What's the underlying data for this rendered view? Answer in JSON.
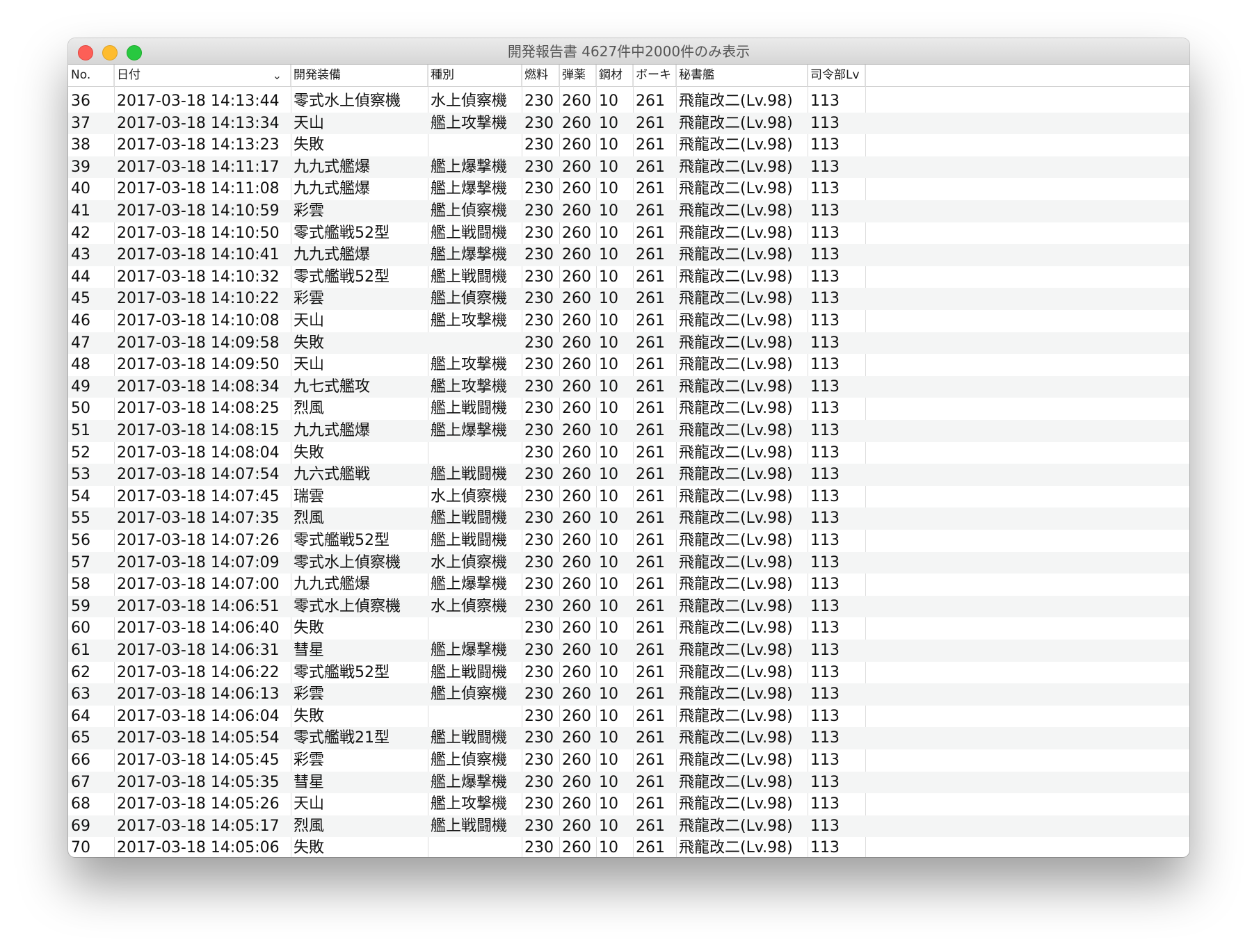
{
  "window": {
    "title": "開発報告書 4627件中2000件のみ表示"
  },
  "columns": {
    "no": "No.",
    "date": "日付",
    "equipment": "開発装備",
    "type": "種別",
    "fuel": "燃料",
    "ammo": "弾薬",
    "steel": "鋼材",
    "bauxite": "ボーキ",
    "secretary": "秘書艦",
    "hq_level": "司令部Lv"
  },
  "rows": [
    [
      "36",
      "2017-03-18 14:13:44",
      "零式水上偵察機",
      "水上偵察機",
      "230",
      "260",
      "10",
      "261",
      "飛龍改二(Lv.98)",
      "113"
    ],
    [
      "37",
      "2017-03-18 14:13:34",
      "天山",
      "艦上攻撃機",
      "230",
      "260",
      "10",
      "261",
      "飛龍改二(Lv.98)",
      "113"
    ],
    [
      "38",
      "2017-03-18 14:13:23",
      "失敗",
      "",
      "230",
      "260",
      "10",
      "261",
      "飛龍改二(Lv.98)",
      "113"
    ],
    [
      "39",
      "2017-03-18 14:11:17",
      "九九式艦爆",
      "艦上爆撃機",
      "230",
      "260",
      "10",
      "261",
      "飛龍改二(Lv.98)",
      "113"
    ],
    [
      "40",
      "2017-03-18 14:11:08",
      "九九式艦爆",
      "艦上爆撃機",
      "230",
      "260",
      "10",
      "261",
      "飛龍改二(Lv.98)",
      "113"
    ],
    [
      "41",
      "2017-03-18 14:10:59",
      "彩雲",
      "艦上偵察機",
      "230",
      "260",
      "10",
      "261",
      "飛龍改二(Lv.98)",
      "113"
    ],
    [
      "42",
      "2017-03-18 14:10:50",
      "零式艦戦52型",
      "艦上戦闘機",
      "230",
      "260",
      "10",
      "261",
      "飛龍改二(Lv.98)",
      "113"
    ],
    [
      "43",
      "2017-03-18 14:10:41",
      "九九式艦爆",
      "艦上爆撃機",
      "230",
      "260",
      "10",
      "261",
      "飛龍改二(Lv.98)",
      "113"
    ],
    [
      "44",
      "2017-03-18 14:10:32",
      "零式艦戦52型",
      "艦上戦闘機",
      "230",
      "260",
      "10",
      "261",
      "飛龍改二(Lv.98)",
      "113"
    ],
    [
      "45",
      "2017-03-18 14:10:22",
      "彩雲",
      "艦上偵察機",
      "230",
      "260",
      "10",
      "261",
      "飛龍改二(Lv.98)",
      "113"
    ],
    [
      "46",
      "2017-03-18 14:10:08",
      "天山",
      "艦上攻撃機",
      "230",
      "260",
      "10",
      "261",
      "飛龍改二(Lv.98)",
      "113"
    ],
    [
      "47",
      "2017-03-18 14:09:58",
      "失敗",
      "",
      "230",
      "260",
      "10",
      "261",
      "飛龍改二(Lv.98)",
      "113"
    ],
    [
      "48",
      "2017-03-18 14:09:50",
      "天山",
      "艦上攻撃機",
      "230",
      "260",
      "10",
      "261",
      "飛龍改二(Lv.98)",
      "113"
    ],
    [
      "49",
      "2017-03-18 14:08:34",
      "九七式艦攻",
      "艦上攻撃機",
      "230",
      "260",
      "10",
      "261",
      "飛龍改二(Lv.98)",
      "113"
    ],
    [
      "50",
      "2017-03-18 14:08:25",
      "烈風",
      "艦上戦闘機",
      "230",
      "260",
      "10",
      "261",
      "飛龍改二(Lv.98)",
      "113"
    ],
    [
      "51",
      "2017-03-18 14:08:15",
      "九九式艦爆",
      "艦上爆撃機",
      "230",
      "260",
      "10",
      "261",
      "飛龍改二(Lv.98)",
      "113"
    ],
    [
      "52",
      "2017-03-18 14:08:04",
      "失敗",
      "",
      "230",
      "260",
      "10",
      "261",
      "飛龍改二(Lv.98)",
      "113"
    ],
    [
      "53",
      "2017-03-18 14:07:54",
      "九六式艦戦",
      "艦上戦闘機",
      "230",
      "260",
      "10",
      "261",
      "飛龍改二(Lv.98)",
      "113"
    ],
    [
      "54",
      "2017-03-18 14:07:45",
      "瑞雲",
      "水上偵察機",
      "230",
      "260",
      "10",
      "261",
      "飛龍改二(Lv.98)",
      "113"
    ],
    [
      "55",
      "2017-03-18 14:07:35",
      "烈風",
      "艦上戦闘機",
      "230",
      "260",
      "10",
      "261",
      "飛龍改二(Lv.98)",
      "113"
    ],
    [
      "56",
      "2017-03-18 14:07:26",
      "零式艦戦52型",
      "艦上戦闘機",
      "230",
      "260",
      "10",
      "261",
      "飛龍改二(Lv.98)",
      "113"
    ],
    [
      "57",
      "2017-03-18 14:07:09",
      "零式水上偵察機",
      "水上偵察機",
      "230",
      "260",
      "10",
      "261",
      "飛龍改二(Lv.98)",
      "113"
    ],
    [
      "58",
      "2017-03-18 14:07:00",
      "九九式艦爆",
      "艦上爆撃機",
      "230",
      "260",
      "10",
      "261",
      "飛龍改二(Lv.98)",
      "113"
    ],
    [
      "59",
      "2017-03-18 14:06:51",
      "零式水上偵察機",
      "水上偵察機",
      "230",
      "260",
      "10",
      "261",
      "飛龍改二(Lv.98)",
      "113"
    ],
    [
      "60",
      "2017-03-18 14:06:40",
      "失敗",
      "",
      "230",
      "260",
      "10",
      "261",
      "飛龍改二(Lv.98)",
      "113"
    ],
    [
      "61",
      "2017-03-18 14:06:31",
      "彗星",
      "艦上爆撃機",
      "230",
      "260",
      "10",
      "261",
      "飛龍改二(Lv.98)",
      "113"
    ],
    [
      "62",
      "2017-03-18 14:06:22",
      "零式艦戦52型",
      "艦上戦闘機",
      "230",
      "260",
      "10",
      "261",
      "飛龍改二(Lv.98)",
      "113"
    ],
    [
      "63",
      "2017-03-18 14:06:13",
      "彩雲",
      "艦上偵察機",
      "230",
      "260",
      "10",
      "261",
      "飛龍改二(Lv.98)",
      "113"
    ],
    [
      "64",
      "2017-03-18 14:06:04",
      "失敗",
      "",
      "230",
      "260",
      "10",
      "261",
      "飛龍改二(Lv.98)",
      "113"
    ],
    [
      "65",
      "2017-03-18 14:05:54",
      "零式艦戦21型",
      "艦上戦闘機",
      "230",
      "260",
      "10",
      "261",
      "飛龍改二(Lv.98)",
      "113"
    ],
    [
      "66",
      "2017-03-18 14:05:45",
      "彩雲",
      "艦上偵察機",
      "230",
      "260",
      "10",
      "261",
      "飛龍改二(Lv.98)",
      "113"
    ],
    [
      "67",
      "2017-03-18 14:05:35",
      "彗星",
      "艦上爆撃機",
      "230",
      "260",
      "10",
      "261",
      "飛龍改二(Lv.98)",
      "113"
    ],
    [
      "68",
      "2017-03-18 14:05:26",
      "天山",
      "艦上攻撃機",
      "230",
      "260",
      "10",
      "261",
      "飛龍改二(Lv.98)",
      "113"
    ],
    [
      "69",
      "2017-03-18 14:05:17",
      "烈風",
      "艦上戦闘機",
      "230",
      "260",
      "10",
      "261",
      "飛龍改二(Lv.98)",
      "113"
    ],
    [
      "70",
      "2017-03-18 14:05:06",
      "失敗",
      "",
      "230",
      "260",
      "10",
      "261",
      "飛龍改二(Lv.98)",
      "113"
    ]
  ]
}
